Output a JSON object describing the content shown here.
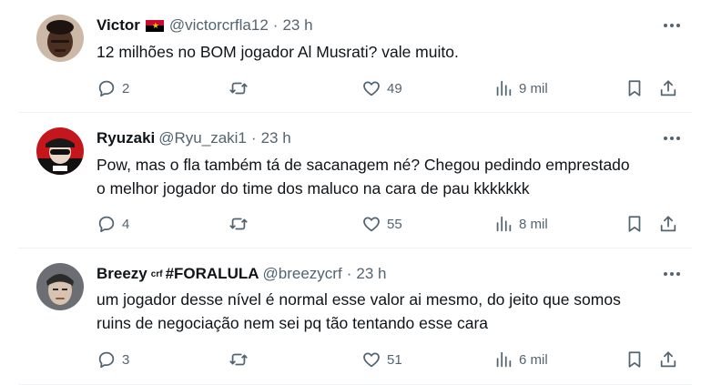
{
  "tweets": [
    {
      "name": "Victor",
      "flag": "angola-flag",
      "handle": "@victorcrfla12",
      "time": "23 h",
      "lines": [
        "12 milhões no BOM jogador Al Musrati? vale muito."
      ],
      "replies": "2",
      "retweets": "",
      "likes": "49",
      "views": "9 mil"
    },
    {
      "name": "Ryuzaki",
      "handle": "@Ryu_zaki1",
      "time": "23 h",
      "lines": [
        "Pow, mas o fla também tá de sacanagem né? Chegou pedindo emprestado",
        "o melhor jogador do time dos maluco na cara de pau kkkkkkk"
      ],
      "replies": "4",
      "retweets": "",
      "likes": "55",
      "views": "8 mil"
    },
    {
      "name": "Breezy",
      "name_superscript": "crf",
      "name_suffix": "#FORALULA",
      "handle": "@breezycrf",
      "time": "23 h",
      "lines": [
        "um jogador desse nível é normal esse valor ai mesmo, do jeito que somos",
        "ruins de negociação nem sei pq tão tentando esse cara"
      ],
      "replies": "3",
      "retweets": "",
      "likes": "51",
      "views": "6 mil"
    }
  ],
  "separator_dot": "·",
  "icons": {
    "reply": "reply-icon",
    "retweet": "retweet-icon",
    "like": "heart-icon",
    "views": "views-chart-icon",
    "bookmark": "bookmark-icon",
    "share": "share-icon",
    "more": "more-options-icon"
  },
  "colors": {
    "text": "#0f1419",
    "secondary": "#536471",
    "border": "#eff3f4",
    "background": "#ffffff"
  }
}
